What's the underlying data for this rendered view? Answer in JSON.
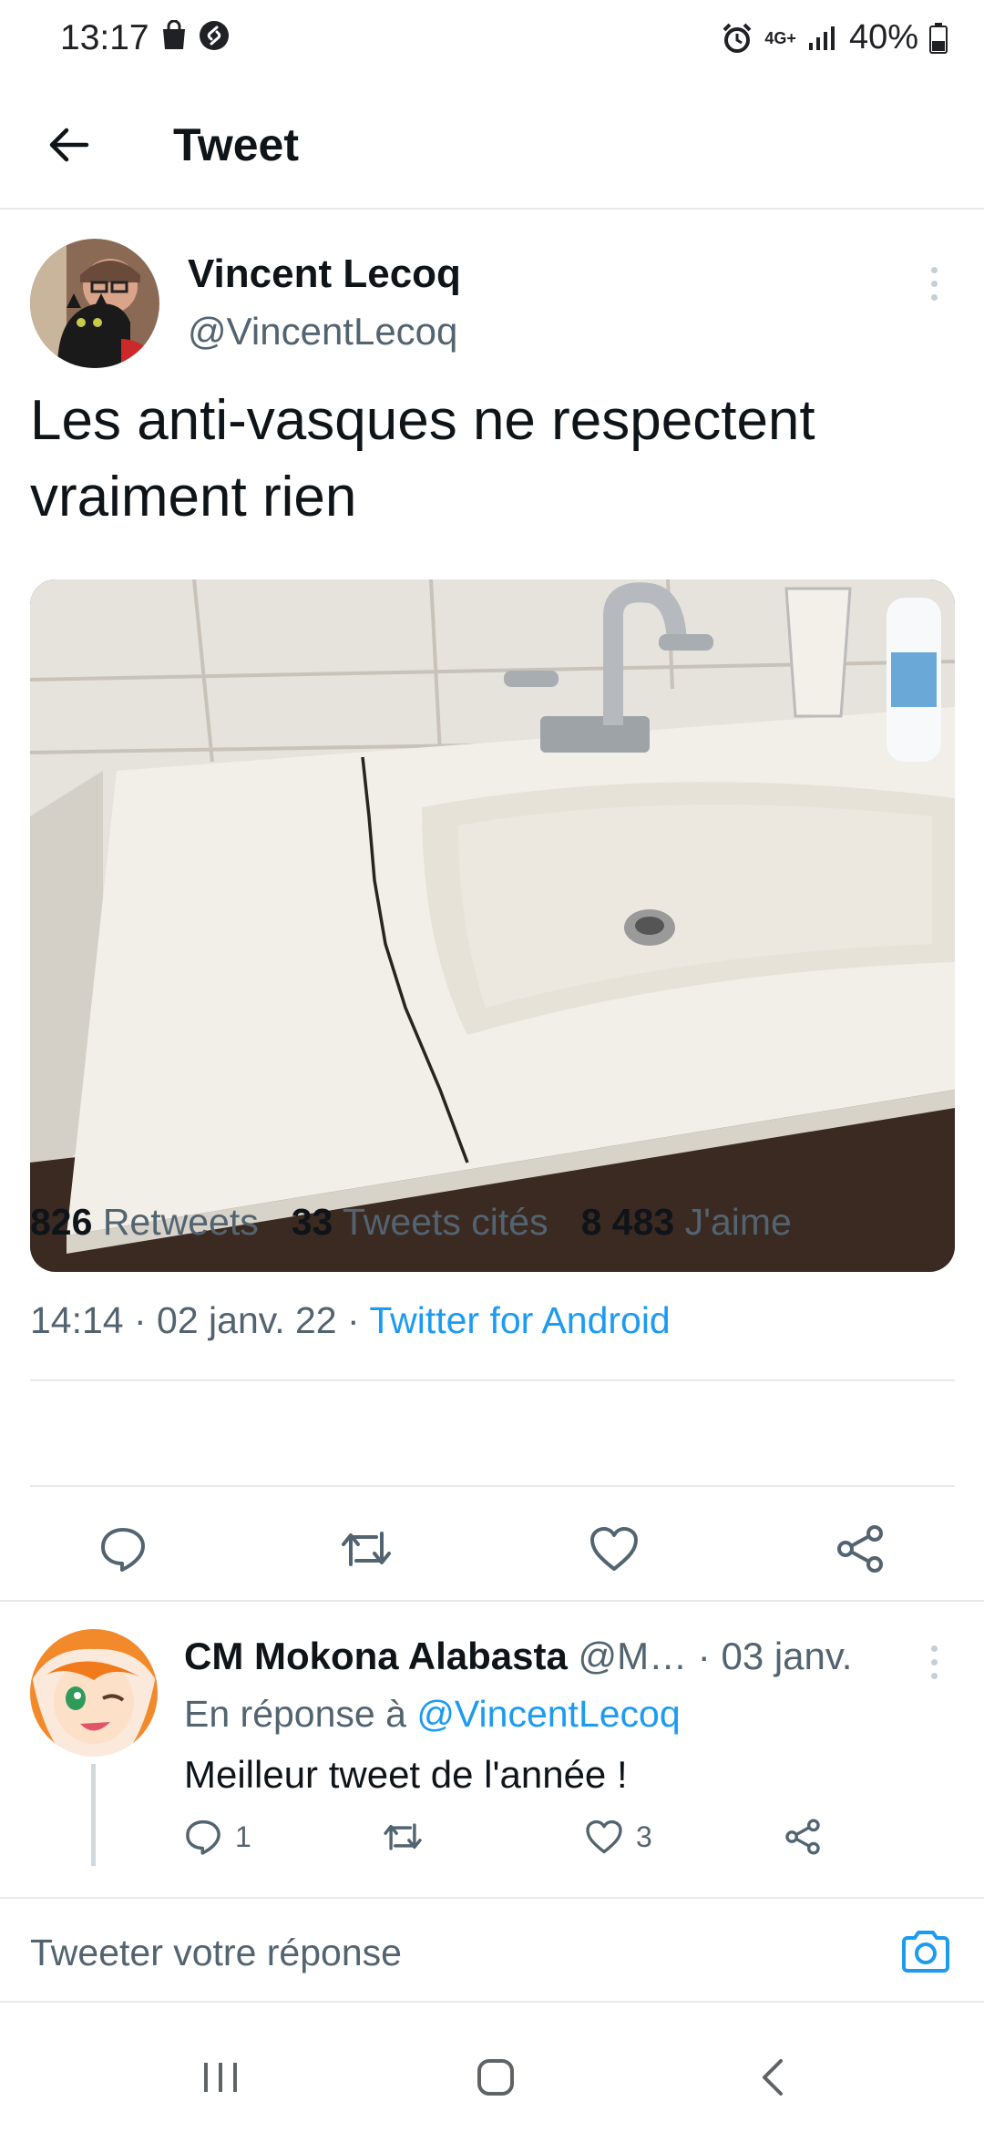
{
  "status_bar": {
    "time": "13:17",
    "network": "4G+",
    "battery": "40%",
    "icons": [
      "shopping-bag-icon",
      "shazam-icon",
      "alarm-icon",
      "network-icon",
      "signal-icon",
      "battery-icon"
    ]
  },
  "header": {
    "title": "Tweet",
    "back_icon": "arrow-left-icon"
  },
  "tweet": {
    "author_name": "Vincent Lecoq",
    "author_handle": "@VincentLecoq",
    "text": "Les anti-vasques ne respectent vraiment rien",
    "media_description": "photo-cracked-bathroom-sink",
    "time": "14:14",
    "date": "02 janv. 22",
    "separator": " · ",
    "source": "Twitter for Android",
    "stats": {
      "retweets_count": "826",
      "retweets_label": "Retweets",
      "quotes_count": "33",
      "quotes_label": "Tweets cités",
      "likes_count": "8 483",
      "likes_label": "J'aime"
    },
    "action_icons": [
      "reply-icon",
      "retweet-icon",
      "like-icon",
      "share-icon"
    ]
  },
  "reply": {
    "author_name": "CM Mokona Alabasta",
    "author_handle": "@M…",
    "separator": " · ",
    "date": "03 janv.",
    "in_reply_to_label": "En réponse à",
    "in_reply_to_handle": "@VincentLecoq",
    "text": "Meilleur tweet de l'année !",
    "reply_count": "1",
    "like_count": "3"
  },
  "compose": {
    "placeholder": "Tweeter votre réponse",
    "camera_icon": "camera-icon"
  },
  "navigation": {
    "icons": [
      "recent-apps-icon",
      "home-icon",
      "back-icon"
    ]
  },
  "colors": {
    "accent": "#1d9bf0",
    "text_primary": "#0f1419",
    "text_secondary": "#536471",
    "divider": "#e7e9ea"
  }
}
